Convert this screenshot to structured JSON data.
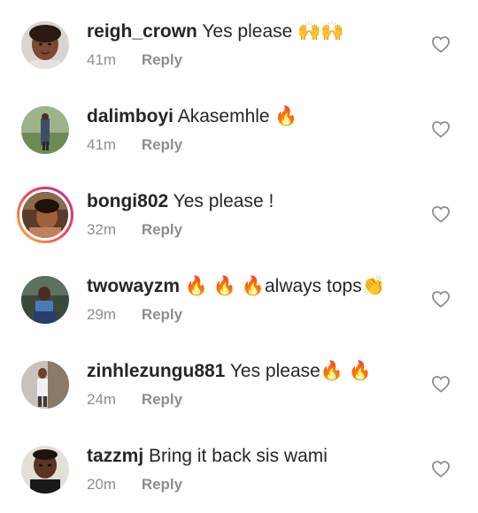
{
  "comments": [
    {
      "username": "reigh_crown",
      "text": "Yes please 🙌🙌",
      "time": "41m",
      "reply_label": "Reply",
      "avatar_icon": "profile-photo"
    },
    {
      "username": "dalimboyi",
      "text": "Akasemhle 🔥",
      "time": "41m",
      "reply_label": "Reply",
      "avatar_icon": "profile-photo"
    },
    {
      "username": "bongi802",
      "text": "Yes please !",
      "time": "32m",
      "reply_label": "Reply",
      "avatar_icon": "profile-photo-story-ring"
    },
    {
      "username": "twowayzm",
      "text": "🔥 🔥 🔥always tops👏",
      "time": "29m",
      "reply_label": "Reply",
      "avatar_icon": "profile-photo"
    },
    {
      "username": "zinhlezungu881",
      "text": "Yes please🔥 🔥",
      "time": "24m",
      "reply_label": "Reply",
      "avatar_icon": "profile-photo"
    },
    {
      "username": "tazzmj",
      "text": "Bring it back sis wami",
      "time": "20m",
      "reply_label": "Reply",
      "avatar_icon": "profile-photo"
    }
  ],
  "like_icon": "heart-outline-icon",
  "colors": {
    "text": "#262626",
    "secondary": "#8e8e8e",
    "story_ring_start": "#f9b53a",
    "story_ring_end": "#c2279a"
  }
}
